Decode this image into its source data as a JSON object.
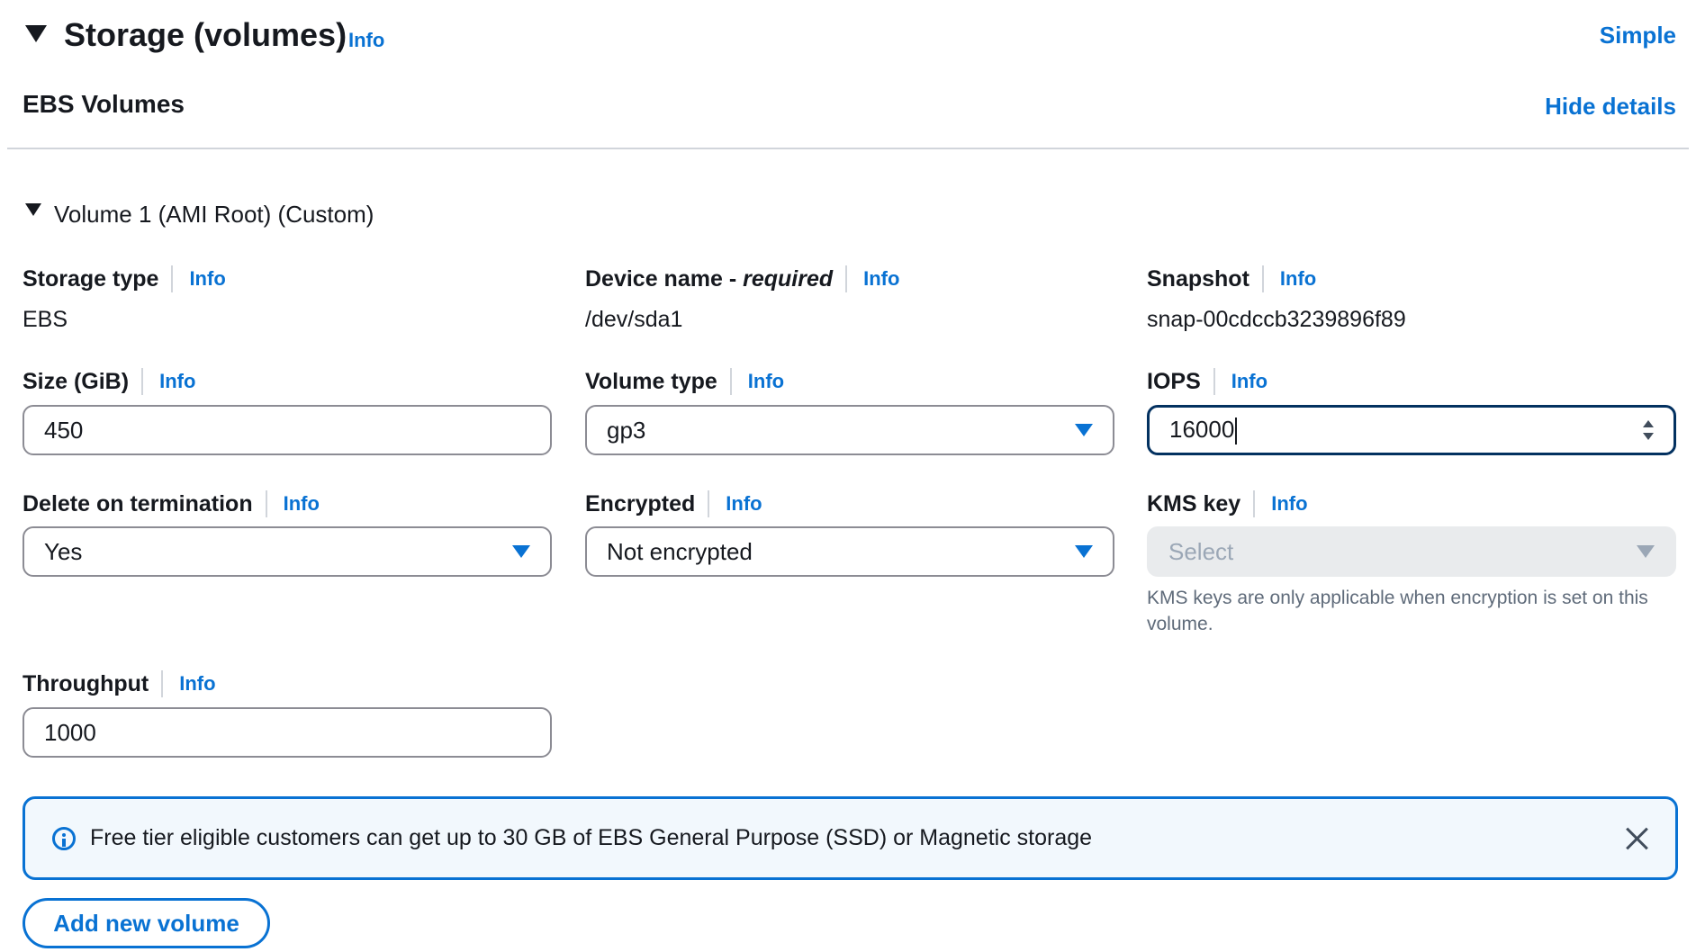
{
  "header": {
    "title": "Storage (volumes)",
    "info_label": "Info",
    "simple_label": "Simple"
  },
  "ebs": {
    "heading": "EBS Volumes",
    "hide_details_label": "Hide details"
  },
  "volume": {
    "title": "Volume 1 (AMI Root) (Custom)",
    "storage_type": {
      "label": "Storage type",
      "info": "Info",
      "value": "EBS"
    },
    "device_name": {
      "label": "Device name - ",
      "label_emphasis": "required",
      "info": "Info",
      "value": "/dev/sda1"
    },
    "snapshot": {
      "label": "Snapshot",
      "info": "Info",
      "value": "snap-00cdccb3239896f89"
    },
    "size": {
      "label": "Size (GiB)",
      "info": "Info",
      "value": "450"
    },
    "volume_type": {
      "label": "Volume type",
      "info": "Info",
      "value": "gp3"
    },
    "iops": {
      "label": "IOPS",
      "info": "Info",
      "value": "16000"
    },
    "delete_on_termination": {
      "label": "Delete on termination",
      "info": "Info",
      "value": "Yes"
    },
    "encrypted": {
      "label": "Encrypted",
      "info": "Info",
      "value": "Not encrypted"
    },
    "kms_key": {
      "label": "KMS key",
      "info": "Info",
      "placeholder": "Select",
      "hint": "KMS keys are only applicable when encryption is set on this volume."
    },
    "throughput": {
      "label": "Throughput",
      "info": "Info",
      "value": "1000"
    }
  },
  "alert": {
    "text": "Free tier eligible customers can get up to 30 GB of EBS General Purpose (SSD) or Magnetic storage"
  },
  "add_volume_label": "Add new volume",
  "colors": {
    "link": "#0972d3",
    "text": "#16191f",
    "focus_border": "#033160",
    "disabled_bg": "#e9ebed",
    "alert_bg": "#f2f8fd"
  },
  "icons": {
    "section_toggle": "caret-down-icon",
    "volume_toggle": "caret-down-icon",
    "dropdown": "triangle-down-icon",
    "alert": "info-circle-icon",
    "dismiss": "close-icon",
    "stepper": "up-down-stepper-icon"
  }
}
